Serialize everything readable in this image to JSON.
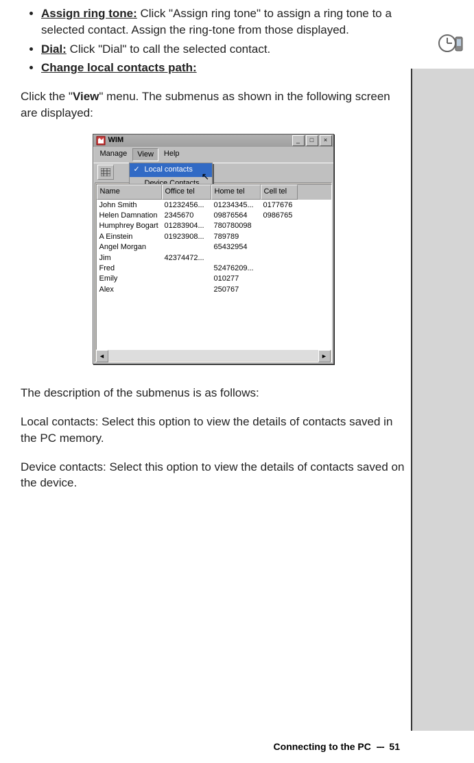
{
  "bullets": {
    "b1_label": "Assign ring tone:",
    "b1_text": " Click \"Assign ring tone\" to assign a ring tone to a selected contact. Assign the ring-tone from those displayed.",
    "b2_label": "Dial:",
    "b2_text": " Click \"Dial\" to call the selected contact.",
    "b3_label": "Change local contacts path:"
  },
  "para1_a": "Click the \"",
  "para1_bold": "View",
  "para1_b": "\" menu. The submenus as shown in the following screen are displayed:",
  "para2": "The description of the submenus is as follows:",
  "para3": "Local contacts: Select this option to view the details of contacts saved in the PC memory.",
  "para4": "Device contacts: Select this option to view the details of contacts saved on the device.",
  "wim": {
    "title": "WIM",
    "menu": {
      "manage": "Manage",
      "view": "View",
      "help": "Help"
    },
    "dropdown": {
      "local": "Local contacts",
      "device": "Device Contacts"
    },
    "headers": {
      "name": "Name",
      "office": "Office tel",
      "home": "Home tel",
      "cell": "Cell tel"
    },
    "rows": [
      {
        "name": "John Smith",
        "office": "01232456...",
        "home": "01234345...",
        "cell": "0177676"
      },
      {
        "name": "Helen Damnation",
        "office": "2345670",
        "home": "09876564",
        "cell": "0986765"
      },
      {
        "name": "Humphrey Bogart",
        "office": "01283904...",
        "home": "780780098",
        "cell": ""
      },
      {
        "name": "A Einstein",
        "office": "01923908...",
        "home": "789789",
        "cell": ""
      },
      {
        "name": "Angel Morgan",
        "office": "",
        "home": "65432954",
        "cell": ""
      },
      {
        "name": "Jim",
        "office": "42374472...",
        "home": "",
        "cell": ""
      },
      {
        "name": "Fred",
        "office": "",
        "home": "52476209...",
        "cell": ""
      },
      {
        "name": "Emily",
        "office": "",
        "home": "010277",
        "cell": ""
      },
      {
        "name": "Alex",
        "office": "",
        "home": "250767",
        "cell": ""
      }
    ],
    "controls": {
      "min": "_",
      "max": "□",
      "close": "×",
      "left": "◄",
      "right": "►"
    }
  },
  "footer": {
    "text": "Connecting to the PC",
    "sep": "---",
    "page": "51"
  }
}
